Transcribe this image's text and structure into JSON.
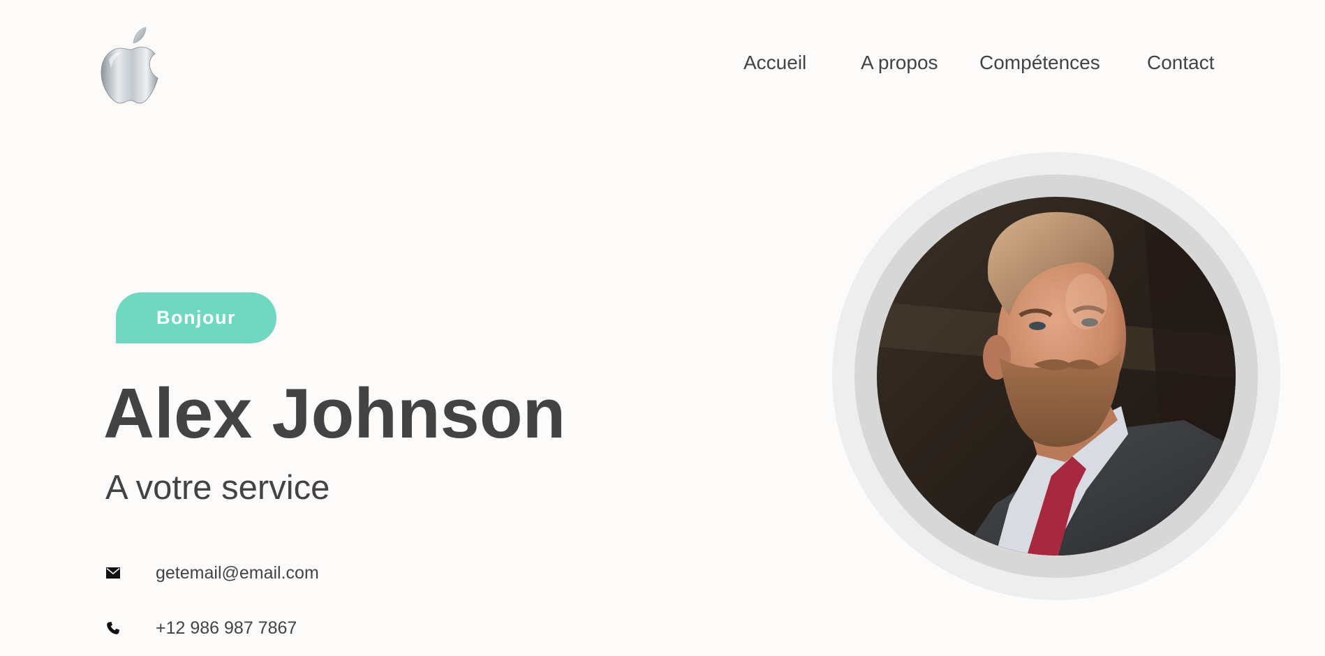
{
  "header": {
    "logo_icon": "apple-logo-icon",
    "nav": [
      {
        "label": "Accueil"
      },
      {
        "label": "A propos"
      },
      {
        "label": "Compétences"
      },
      {
        "label": "Contact"
      }
    ]
  },
  "hero": {
    "badge": "Bonjour",
    "name": "Alex Johnson",
    "subtitle": "A votre service",
    "contacts": [
      {
        "icon": "envelope-icon",
        "text": "getemail@email.com"
      },
      {
        "icon": "phone-icon",
        "text": "+12 986 987 7867"
      }
    ],
    "portrait_icon": "portrait-photo"
  },
  "colors": {
    "background": "#fdfafa",
    "text": "#434343",
    "accent": "#70d8c1",
    "ring_outer": "#efeeee",
    "ring_inner": "#d7d7d7"
  }
}
